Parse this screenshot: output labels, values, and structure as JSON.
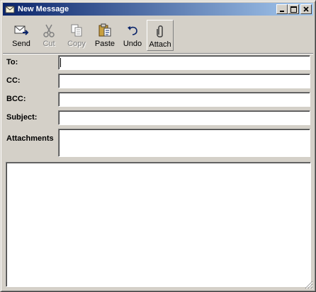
{
  "window": {
    "title": "New Message"
  },
  "titlebar": {
    "buttons": [
      {
        "name": "minimize",
        "icon": "minimize-icon"
      },
      {
        "name": "maximize",
        "icon": "maximize-icon"
      },
      {
        "name": "close",
        "icon": "close-icon"
      }
    ]
  },
  "toolbar": {
    "send_label": "Send",
    "cut_label": "Cut",
    "copy_label": "Copy",
    "paste_label": "Paste",
    "undo_label": "Undo",
    "attach_label": "Attach",
    "disabled": [
      "Cut",
      "Copy"
    ],
    "pressed": "Attach"
  },
  "form": {
    "to_label": "To:",
    "to_value": "",
    "cc_label": "CC:",
    "cc_value": "",
    "bcc_label": "BCC:",
    "bcc_value": "",
    "subject_label": "Subject:",
    "subject_value": "",
    "attachments_label": "Attachments",
    "attachments_value": ""
  },
  "body": {
    "value": ""
  },
  "colors": {
    "titlebar_start": "#0a246a",
    "titlebar_end": "#a6caf0",
    "face": "#d4d0c8",
    "field_bg": "#ffffff"
  }
}
